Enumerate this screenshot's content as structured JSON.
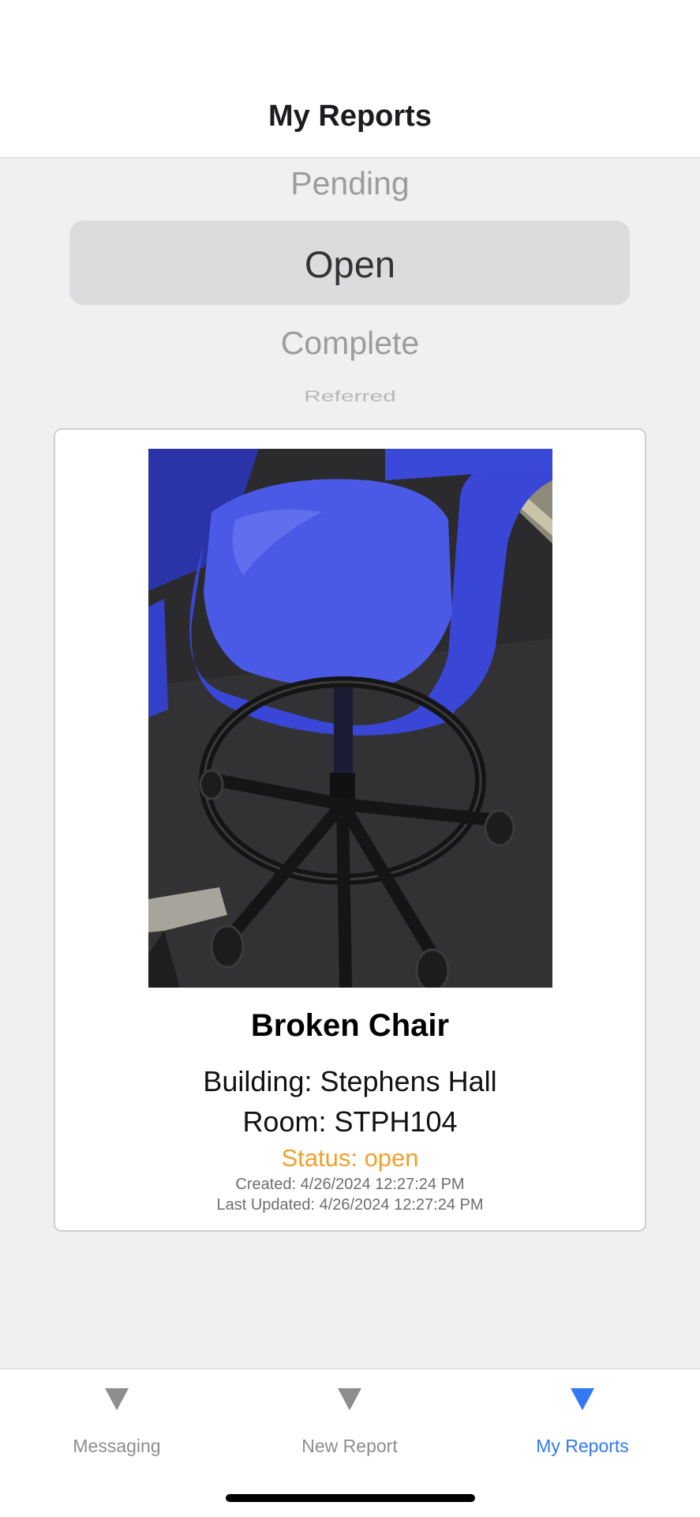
{
  "header": {
    "title": "My Reports"
  },
  "status_picker": {
    "options": [
      "Pending",
      "Open",
      "Complete",
      "Referred"
    ],
    "selected": "Open"
  },
  "report": {
    "title": "Broken Chair",
    "building": "Building: Stephens Hall",
    "room": "Room: STPH104",
    "status": "Status: open",
    "created": "Created: 4/26/2024 12:27:24 PM",
    "updated": "Last Updated: 4/26/2024 12:27:24 PM",
    "status_color": "#f0a02c"
  },
  "tabs": [
    {
      "label": "Messaging",
      "icon": "triangle-down-icon",
      "active": false
    },
    {
      "label": "New Report",
      "icon": "triangle-down-icon",
      "active": false
    },
    {
      "label": "My Reports",
      "icon": "triangle-down-icon",
      "active": true
    }
  ],
  "colors": {
    "accent": "#3478f6",
    "inactive": "#8e8e8e"
  }
}
